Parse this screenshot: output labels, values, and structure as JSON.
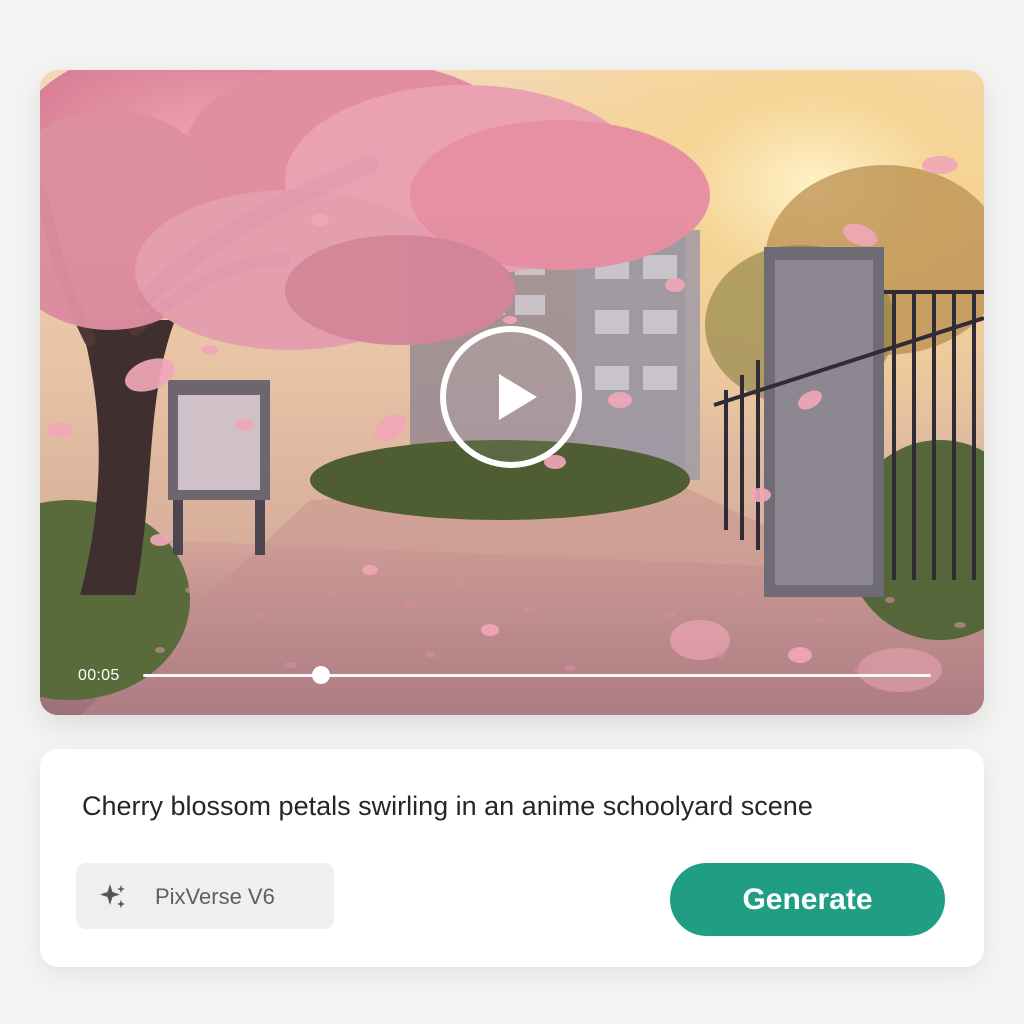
{
  "player": {
    "current_time": "00:05",
    "progress_fraction": 0.22
  },
  "prompt": {
    "text": "Cherry blossom petals swirling in an anime schoolyard scene"
  },
  "model": {
    "label": "PixVerse V6"
  },
  "actions": {
    "generate_label": "Generate"
  },
  "colors": {
    "accent": "#1f9e84",
    "background": "#f4f4f3",
    "card": "#ffffff"
  },
  "icons": {
    "play": "play-icon",
    "model": "sparkle-icon"
  }
}
